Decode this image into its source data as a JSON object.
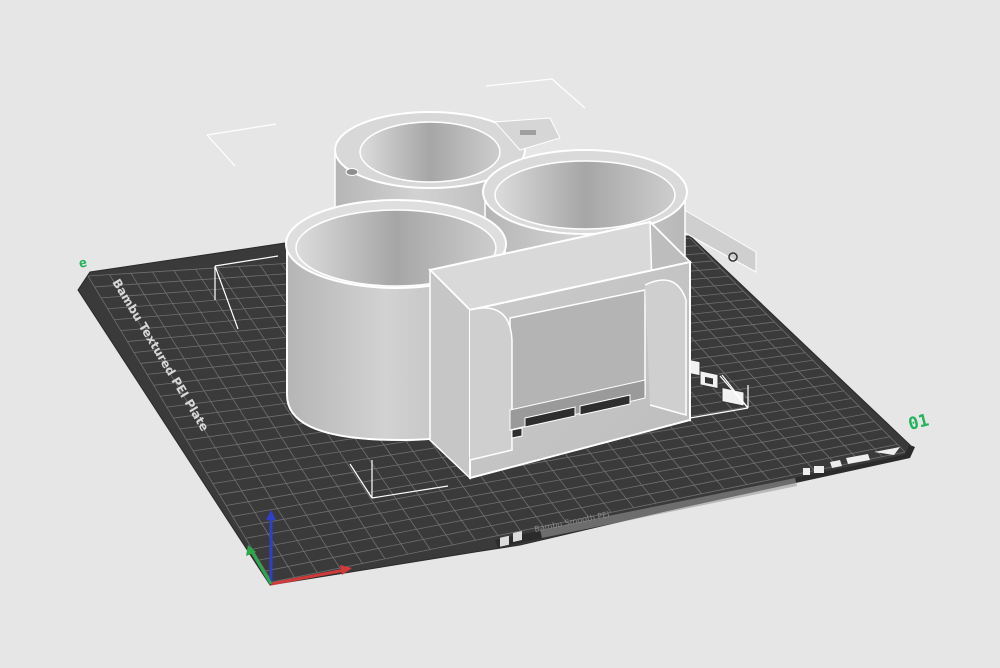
{
  "viewport": {
    "plate_label": "Bambu Textured PEI Plate",
    "plate_number": "01",
    "plate_index_glyph": "e",
    "colors": {
      "background": "#e6e6e6",
      "plate": "#3b3b3b",
      "grid": "#7a7a7a",
      "model": "#c4c4c4",
      "model_inner": "#a9a9a9",
      "model_top": "#dedede",
      "selection_box": "#ffffff",
      "plate_number_green": "#1fb35a",
      "axis_x": "#d23a3a",
      "axis_y": "#2aa84a",
      "axis_z": "#2f3fc9"
    }
  },
  "plate_toolbar": {
    "icons": [
      "plate-list-icon",
      "lock-icon",
      "settings-icon"
    ]
  },
  "plate_strip": {
    "icons": [
      "filament-icon",
      "plate-icon",
      "edit-icon"
    ],
    "label": "Bambu Smooth PEI"
  },
  "axes": [
    "x",
    "y",
    "z"
  ]
}
